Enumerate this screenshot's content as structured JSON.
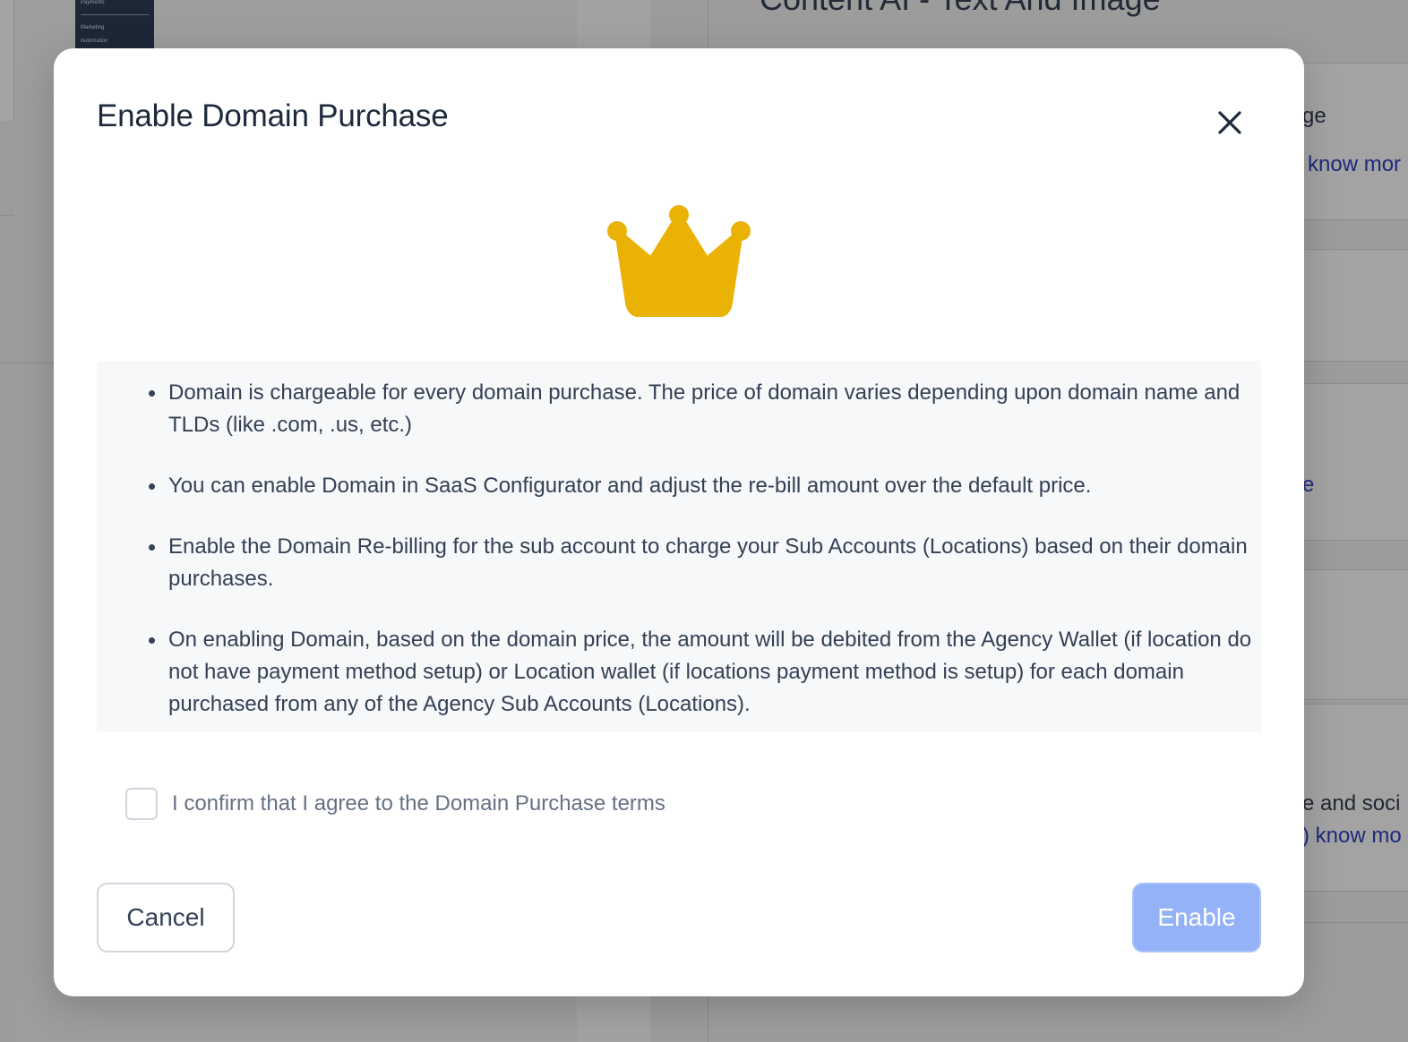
{
  "background": {
    "nav_items": [
      "Payments",
      "Marketing",
      "Automation"
    ],
    "page_title": "Content AI - Text And Image",
    "right_snippets": [
      {
        "text": "ge",
        "style": "dark"
      },
      {
        "text": "know mor",
        "style": "link"
      },
      {
        "text": "e",
        "style": "link"
      },
      {
        "text": "e and soci",
        "style": "dark"
      },
      {
        "text": ") know mo",
        "style": "link"
      }
    ]
  },
  "modal": {
    "title": "Enable Domain Purchase",
    "icon": "crown-icon",
    "close_icon": "close-icon",
    "bullets": [
      "Domain is chargeable for every domain purchase. The price of domain varies depending upon domain name and TLDs (like .com, .us, etc.)",
      "You can enable Domain in SaaS Configurator and adjust the re-bill amount over the default price.",
      "Enable the Domain Re-billing for the sub account to charge your Sub Accounts (Locations) based on their domain purchases.",
      "On enabling Domain, based on the domain price, the amount will be debited from the Agency Wallet (if location do not have payment method setup) or Location wallet (if locations payment method is setup) for each domain purchased from any of the Agency Sub Accounts (Locations)."
    ],
    "confirm_label": "I confirm that I agree to the Domain Purchase terms",
    "confirm_checked": false,
    "cancel_label": "Cancel",
    "enable_label": "Enable",
    "enable_disabled": true
  },
  "colors": {
    "crown": "#ebb206",
    "primary_disabled": "#93b2f8",
    "text_primary": "#1e293b",
    "text_body": "#344054",
    "text_muted": "#667085"
  }
}
